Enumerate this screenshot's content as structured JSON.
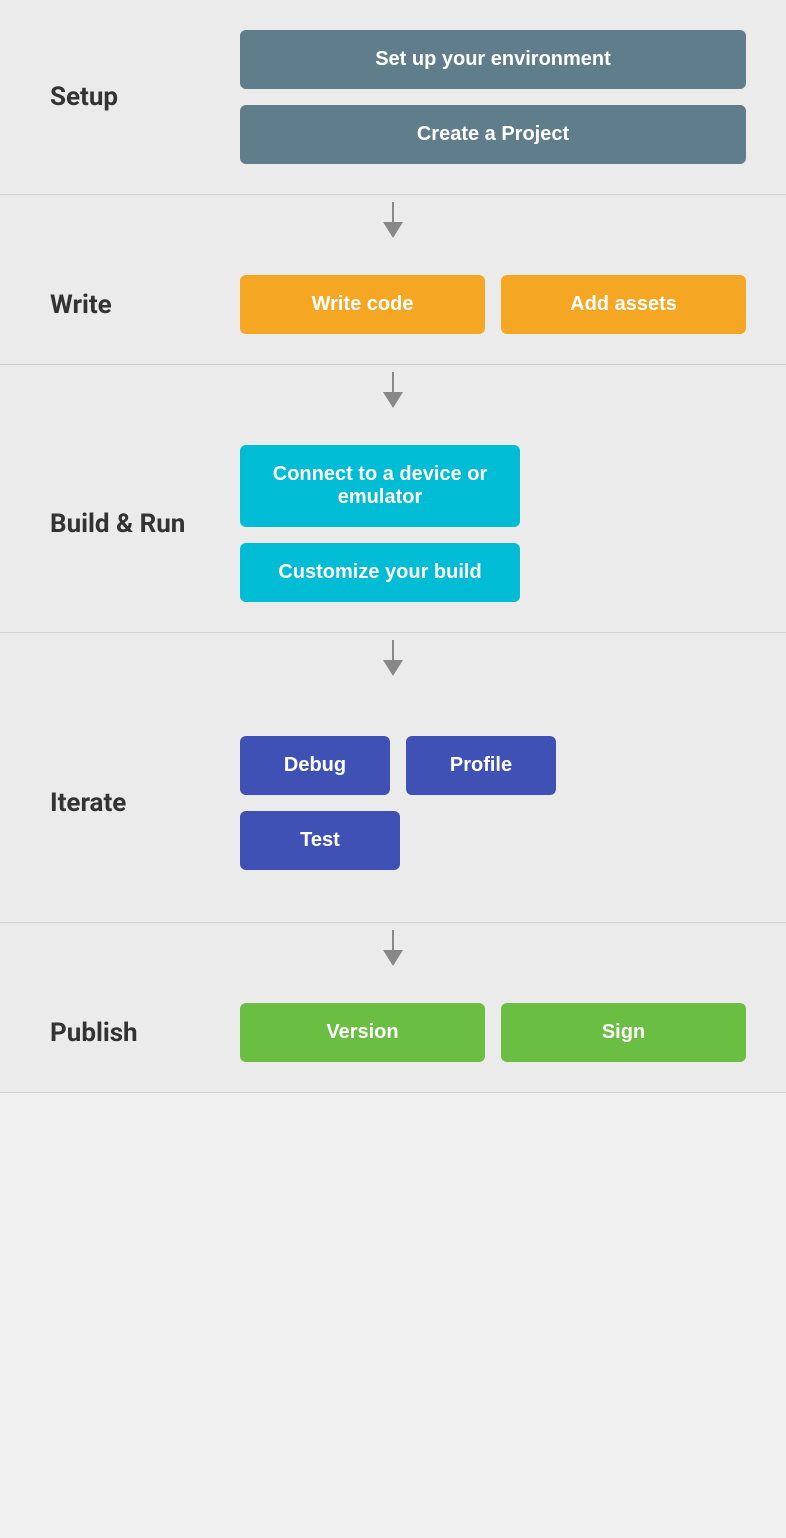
{
  "sections": {
    "setup": {
      "label": "Setup",
      "buttons": [
        {
          "text": "Set up your environment",
          "style": "gray"
        },
        {
          "text": "Create a Project",
          "style": "gray"
        }
      ]
    },
    "write": {
      "label": "Write",
      "buttons": [
        {
          "text": "Write code",
          "style": "orange"
        },
        {
          "text": "Add assets",
          "style": "orange"
        }
      ]
    },
    "buildrun": {
      "label": "Build & Run",
      "buttons": [
        {
          "text": "Connect to a device or emulator",
          "style": "cyan"
        },
        {
          "text": "Customize your build",
          "style": "cyan"
        }
      ]
    },
    "iterate": {
      "label": "Iterate",
      "buttons_row1": [
        {
          "text": "Debug",
          "style": "blue"
        },
        {
          "text": "Profile",
          "style": "blue"
        }
      ],
      "buttons_row2": [
        {
          "text": "Test",
          "style": "blue"
        }
      ]
    },
    "publish": {
      "label": "Publish",
      "buttons": [
        {
          "text": "Version",
          "style": "green"
        },
        {
          "text": "Sign",
          "style": "green"
        }
      ]
    }
  }
}
